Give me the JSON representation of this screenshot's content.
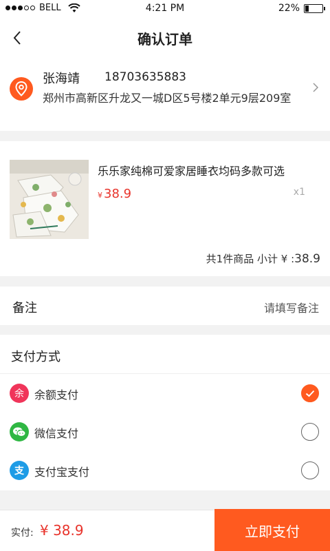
{
  "status_bar": {
    "carrier": "BELL",
    "time": "4:21 PM",
    "battery_text": "22%",
    "battery_level": 0.22
  },
  "nav": {
    "title": "确认订单"
  },
  "address": {
    "name": "张海靖",
    "phone": "18703635883",
    "detail": "郑州市高新区升龙又一城D区5号楼2单元9层209室"
  },
  "product": {
    "title": "乐乐家纯棉可爱家居睡衣均码多款可选",
    "currency": "¥",
    "price": "38.9",
    "quantity": "x1",
    "summary_count": "共1件商品",
    "summary_subtotal_label": "小计 ¥ :",
    "summary_subtotal_value": "38.9"
  },
  "remark": {
    "label": "备注",
    "placeholder": "请填写备注"
  },
  "payment": {
    "title": "支付方式",
    "options": [
      {
        "label": "余额支付",
        "icon": "balance-icon",
        "icon_char": "余",
        "color": "#f0355a",
        "selected": true
      },
      {
        "label": "微信支付",
        "icon": "wechat-icon",
        "color": "#2fb743",
        "selected": false
      },
      {
        "label": "支付宝支付",
        "icon": "alipay-icon",
        "icon_char": "支",
        "color": "#1e9ce6",
        "selected": false
      }
    ]
  },
  "footer": {
    "label": "实付:",
    "amount": "¥ 38.9",
    "pay_button": "立即支付"
  },
  "colors": {
    "accent": "#ff5a1f",
    "price": "#e8332b"
  }
}
